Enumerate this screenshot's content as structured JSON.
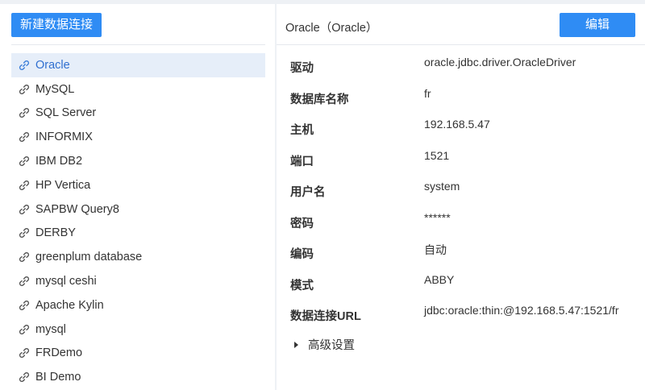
{
  "toolbar": {
    "new_connection_label": "新建数据连接",
    "edit_label": "编辑"
  },
  "connections": [
    {
      "label": "Oracle",
      "active": true
    },
    {
      "label": "MySQL"
    },
    {
      "label": "SQL Server"
    },
    {
      "label": "INFORMIX"
    },
    {
      "label": "IBM DB2"
    },
    {
      "label": "HP Vertica"
    },
    {
      "label": "SAPBW Query8"
    },
    {
      "label": "DERBY"
    },
    {
      "label": "greenplum database"
    },
    {
      "label": "mysql ceshi"
    },
    {
      "label": "Apache Kylin"
    },
    {
      "label": "mysql"
    },
    {
      "label": "FRDemo"
    },
    {
      "label": "BI Demo"
    }
  ],
  "detail": {
    "title": "Oracle（Oracle）",
    "fields": [
      {
        "label": "驱动",
        "value": "oracle.jdbc.driver.OracleDriver"
      },
      {
        "label": "数据库名称",
        "value": "fr"
      },
      {
        "label": "主机",
        "value": "192.168.5.47"
      },
      {
        "label": "端口",
        "value": "1521"
      },
      {
        "label": "用户名",
        "value": "system"
      },
      {
        "label": "密码",
        "value": "******"
      },
      {
        "label": "编码",
        "value": "自动"
      },
      {
        "label": "模式",
        "value": "ABBY"
      },
      {
        "label": "数据连接URL",
        "value": "jdbc:oracle:thin:@192.168.5.47:1521/fr"
      }
    ],
    "advanced_label": "高级设置"
  },
  "colors": {
    "primary": "#2f8cf4",
    "active_bg": "#e6eef9",
    "active_text": "#2f6fd0"
  },
  "icons": {
    "connection": "link-icon",
    "expand": "caret-right-icon"
  }
}
